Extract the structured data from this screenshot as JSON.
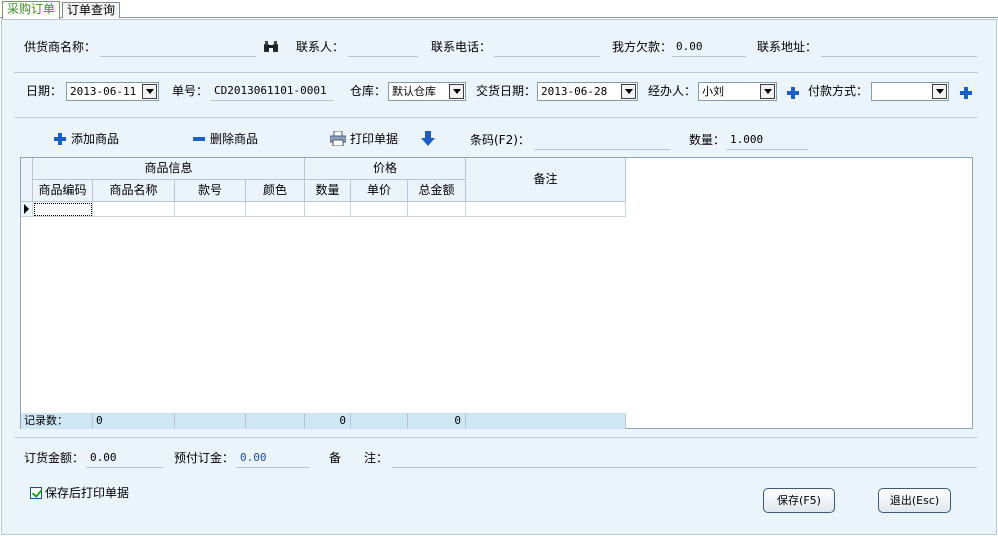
{
  "tabs": [
    {
      "label": "采购订单",
      "active": true
    },
    {
      "label": "订单查询",
      "active": false
    }
  ],
  "supplier_row": {
    "supplier_label": "供货商名称：",
    "supplier_value": "",
    "contact_label": "联系人：",
    "contact_value": "",
    "phone_label": "联系电话：",
    "phone_value": "",
    "debt_label": "我方欠款：",
    "debt_value": "0.00",
    "address_label": "联系地址：",
    "address_value": ""
  },
  "order_row": {
    "date_label": "日期：",
    "date_value": "2013-06-11",
    "number_label": "单号：",
    "number_value": "CD2013061101-0001",
    "warehouse_label": "仓库：",
    "warehouse_value": "默认仓库",
    "delivery_label": "交货日期：",
    "delivery_value": "2013-06-28",
    "handler_label": "经办人：",
    "handler_value": "小刘",
    "payment_label": "付款方式：",
    "payment_value": ""
  },
  "toolbar": {
    "add_label": "添加商品",
    "delete_label": "删除商品",
    "print_label": "打印单据",
    "barcode_label": "条码(F2)：",
    "barcode_value": "",
    "qty_label": "数量：",
    "qty_value": "1.000"
  },
  "grid": {
    "group_product": "商品信息",
    "group_price": "价格",
    "remark_header": "备注",
    "columns": [
      "商品编码",
      "商品名称",
      "款号",
      "颜色",
      "数量",
      "单价",
      "总金额"
    ],
    "footer": {
      "records_label": "记录数：",
      "records_value": "0",
      "qty_total": "0",
      "amount_total": "0"
    }
  },
  "bottom": {
    "order_amount_label": "订货金额：",
    "order_amount_value": "0.00",
    "deposit_label": "预付订金：",
    "deposit_value": "0.00",
    "remark_label_a": "备",
    "remark_label_b": "注：",
    "remark_value": "",
    "print_after_save_label": "保存后打印单据",
    "print_after_save_checked": true,
    "save_button": "保存(F5)",
    "exit_button": "退出(Esc)"
  },
  "colors": {
    "panel_bg": "#ebf3fb",
    "accent_blue": "#1a5fc9",
    "active_tab_text": "#3a8a1e",
    "grid_footer": "#cfe6f5"
  }
}
